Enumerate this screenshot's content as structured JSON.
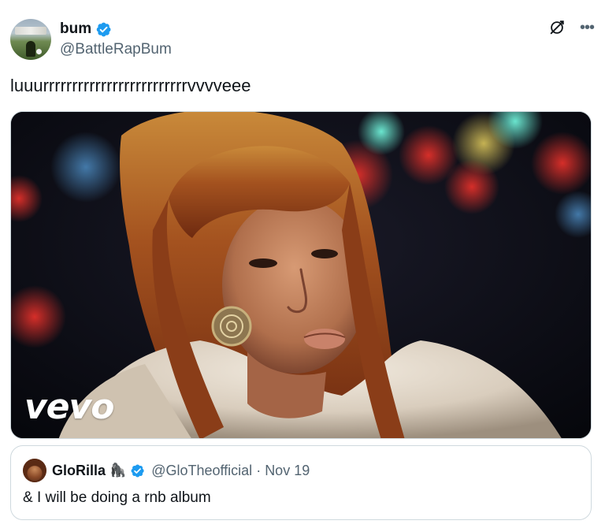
{
  "author": {
    "display_name": "bum",
    "handle": "@BattleRapBum",
    "verified": true,
    "avatar_icon": "avatar-stadium-photo"
  },
  "tweet": {
    "text": "luuurrrrrrrrrrrrrrrrrrrrrrrrrvvvveee"
  },
  "media": {
    "watermark": "vevo",
    "description_icon": "music-video-still"
  },
  "quoted_tweet": {
    "display_name": "GloRilla",
    "emoji": "🦍",
    "verified": true,
    "handle": "@GloTheofficial",
    "separator": "·",
    "date": "Nov 19",
    "text": "& I will be doing a rnb album"
  },
  "colors": {
    "verified_blue": "#1d9bf0",
    "secondary_text": "#536471",
    "border": "#cfd9de",
    "primary_text": "#0f1419"
  }
}
